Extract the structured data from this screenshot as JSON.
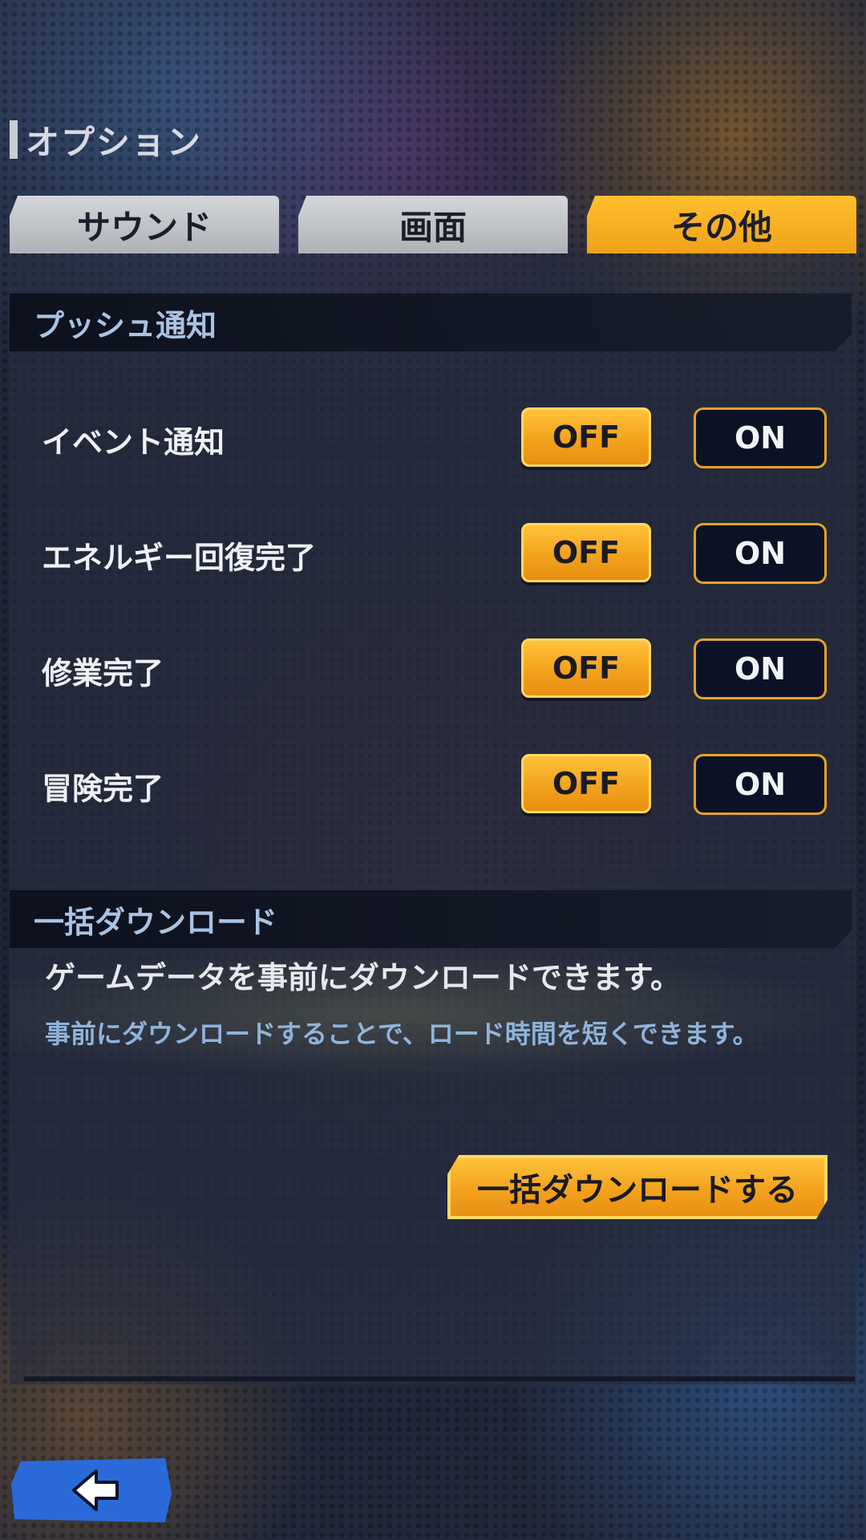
{
  "header": {
    "title": "オプション"
  },
  "tabs": [
    {
      "label": "サウンド",
      "active": false
    },
    {
      "label": "画面",
      "active": false
    },
    {
      "label": "その他",
      "active": true
    }
  ],
  "push": {
    "heading": "プッシュ通知",
    "rows": [
      {
        "label": "イベント通知",
        "off_label": "OFF",
        "on_label": "ON",
        "selected": "OFF"
      },
      {
        "label": "エネルギー回復完了",
        "off_label": "OFF",
        "on_label": "ON",
        "selected": "OFF"
      },
      {
        "label": "修業完了",
        "off_label": "OFF",
        "on_label": "ON",
        "selected": "OFF"
      },
      {
        "label": "冒険完了",
        "off_label": "OFF",
        "on_label": "ON",
        "selected": "OFF"
      }
    ]
  },
  "download": {
    "heading": "一括ダウンロード",
    "description": "ゲームデータを事前にダウンロードできます。",
    "note": "事前にダウンロードすることで、ロード時間を短くできます。",
    "button_label": "一括ダウンロードする"
  },
  "back": {
    "icon": "back-arrow-icon"
  },
  "colors": {
    "accent": "#f3a21d",
    "on_bg": "#0c1226",
    "heading_text": "#a9c3e2",
    "back_button": "#2a6ad8"
  }
}
